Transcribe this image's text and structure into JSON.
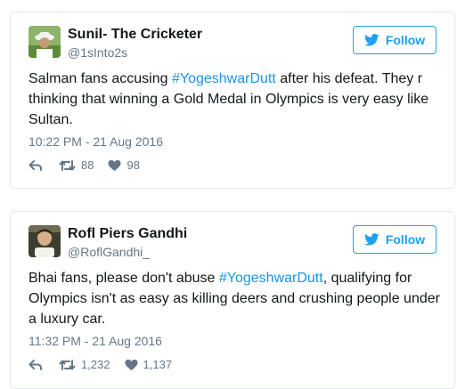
{
  "colors": {
    "accent": "#1da1f2",
    "hashtag": "#1b95e0",
    "muted": "#657786",
    "border": "#e1e8ed"
  },
  "tweets": [
    {
      "name": "Sunil- The Cricketer",
      "handle": "@1sInto2s",
      "follow_label": "Follow",
      "text_before": "Salman fans accusing ",
      "hashtag": "#YogeshwarDutt",
      "text_after": " after his defeat. They r thinking that winning a Gold Medal in Olympics is very easy like Sultan.",
      "timestamp": "10:22 PM - 21 Aug 2016",
      "retweets": "88",
      "likes": "98",
      "icons": [
        "reply-icon",
        "retweet-icon",
        "heart-icon",
        "twitter-bird-icon"
      ]
    },
    {
      "name": "Rofl Piers Gandhi",
      "handle": "@RoflGandhi_",
      "follow_label": "Follow",
      "text_before": "Bhai fans, please don't abuse ",
      "hashtag": "#YogeshwarDutt",
      "text_after": ", qualifying for Olympics isn't as easy as killing deers and crushing people under a luxury car.",
      "timestamp": "11:32 PM - 21 Aug 2016",
      "retweets": "1,232",
      "likes": "1,137",
      "icons": [
        "reply-icon",
        "retweet-icon",
        "heart-icon",
        "twitter-bird-icon"
      ]
    }
  ]
}
